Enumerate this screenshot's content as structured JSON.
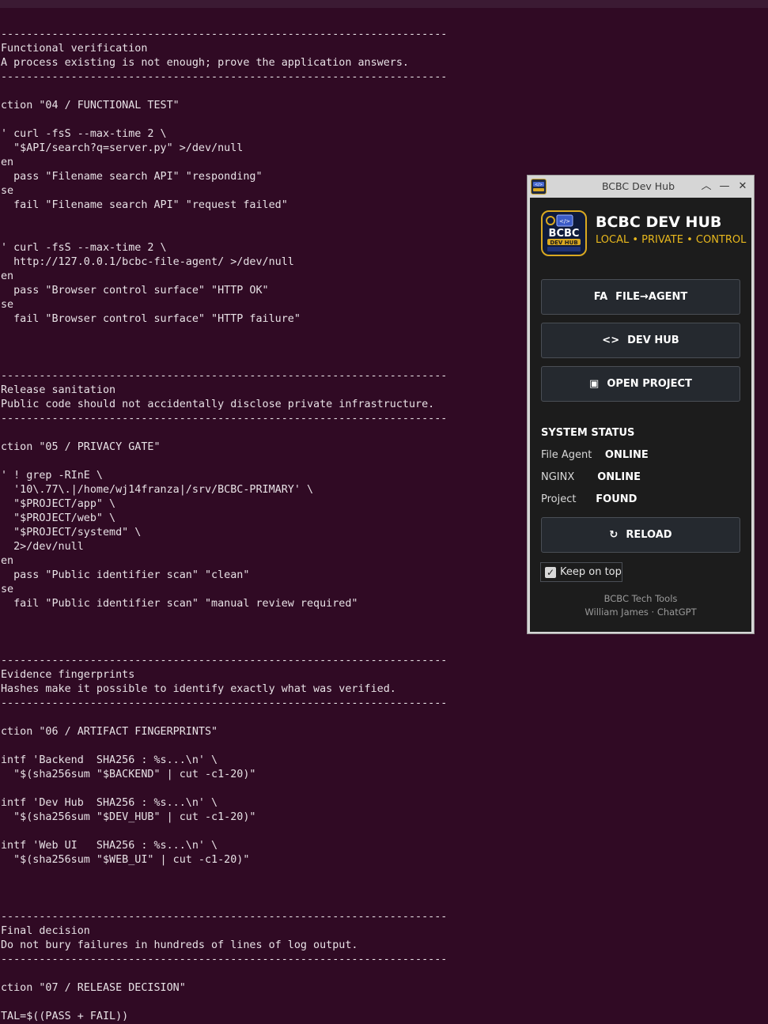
{
  "terminal_lines": [
    "----------------------------------------------------------------------",
    "Functional verification",
    "A process existing is not enough; prove the application answers.",
    "----------------------------------------------------------------------",
    "",
    "ction \"04 / FUNCTIONAL TEST\"",
    "",
    "' curl -fsS --max-time 2 \\",
    "  \"$API/search?q=server.py\" >/dev/null",
    "en",
    "  pass \"Filename search API\" \"responding\"",
    "se",
    "  fail \"Filename search API\" \"request failed\"",
    "",
    "",
    "' curl -fsS --max-time 2 \\",
    "  http://127.0.0.1/bcbc-file-agent/ >/dev/null",
    "en",
    "  pass \"Browser control surface\" \"HTTP OK\"",
    "se",
    "  fail \"Browser control surface\" \"HTTP failure\"",
    "",
    "",
    "",
    "----------------------------------------------------------------------",
    "Release sanitation",
    "Public code should not accidentally disclose private infrastructure.",
    "----------------------------------------------------------------------",
    "",
    "ction \"05 / PRIVACY GATE\"",
    "",
    "' ! grep -RInE \\",
    "  '10\\.77\\.|/home/wj14franza|/srv/BCBC-PRIMARY' \\",
    "  \"$PROJECT/app\" \\",
    "  \"$PROJECT/web\" \\",
    "  \"$PROJECT/systemd\" \\",
    "  2>/dev/null",
    "en",
    "  pass \"Public identifier scan\" \"clean\"",
    "se",
    "  fail \"Public identifier scan\" \"manual review required\"",
    "",
    "",
    "",
    "----------------------------------------------------------------------",
    "Evidence fingerprints",
    "Hashes make it possible to identify exactly what was verified.",
    "----------------------------------------------------------------------",
    "",
    "ction \"06 / ARTIFACT FINGERPRINTS\"",
    "",
    "intf 'Backend  SHA256 : %s...\\n' \\",
    "  \"$(sha256sum \"$BACKEND\" | cut -c1-20)\"",
    "",
    "intf 'Dev Hub  SHA256 : %s...\\n' \\",
    "  \"$(sha256sum \"$DEV_HUB\" | cut -c1-20)\"",
    "",
    "intf 'Web UI   SHA256 : %s...\\n' \\",
    "  \"$(sha256sum \"$WEB_UI\" | cut -c1-20)\"",
    "",
    "",
    "",
    "----------------------------------------------------------------------",
    "Final decision",
    "Do not bury failures in hundreds of lines of log output.",
    "----------------------------------------------------------------------",
    "",
    "ction \"07 / RELEASE DECISION\"",
    "",
    "TAL=$((PASS + FAIL))"
  ],
  "hub": {
    "window_title": "BCBC Dev Hub",
    "app_name": "BCBC DEV HUB",
    "tagline": "LOCAL • PRIVATE • CONTROL",
    "logo_text_top": "BCBC",
    "logo_text_bottom": "DEV HUB",
    "buttons": [
      {
        "icon": "FA",
        "label": "FILE→AGENT"
      },
      {
        "icon": "<>",
        "label": "DEV HUB"
      },
      {
        "icon": "▣",
        "label": "OPEN PROJECT"
      }
    ],
    "status_heading": "SYSTEM STATUS",
    "status": [
      {
        "label": "File Agent",
        "value": "ONLINE"
      },
      {
        "label": "NGINX",
        "value": "ONLINE"
      },
      {
        "label": "Project",
        "value": "FOUND"
      }
    ],
    "reload": {
      "icon": "↻",
      "label": "RELOAD"
    },
    "keep_on_top": {
      "label": "Keep on top",
      "checked": true
    },
    "footer_line1": "BCBC Tech Tools",
    "footer_line2": "William James · ChatGPT"
  },
  "colors": {
    "terminal_bg": "#300a24",
    "accent_gold": "#e8b81d",
    "panel_bg": "#1c1c1c"
  }
}
